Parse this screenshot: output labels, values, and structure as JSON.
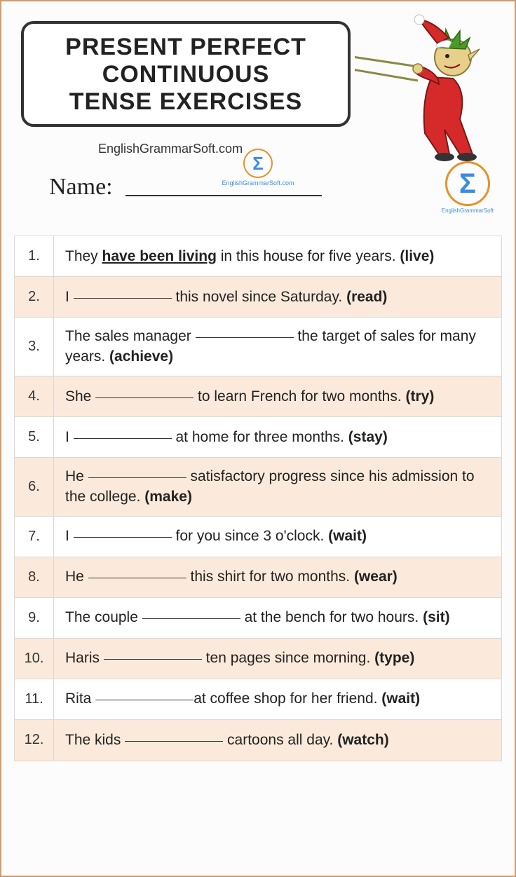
{
  "title_line1": "PRESENT PERFECT",
  "title_line2": "CONTINUOUS",
  "title_line3": "TENSE EXERCISES",
  "site": "EnglishGrammarSoft.com",
  "name_label": "Name:",
  "logo_text": "EnglishGrammarSoft",
  "exercises": [
    {
      "num": "1.",
      "pre": "They ",
      "answer": "have been living",
      "post": " in this house for five years. ",
      "verb": "(live)",
      "has_answer": true
    },
    {
      "num": "2.",
      "pre": "I ",
      "post": " this novel since Saturday. ",
      "verb": "(read)"
    },
    {
      "num": "3.",
      "pre": "The sales manager ",
      "post": " the target of sales for many years. ",
      "verb": "(achieve)"
    },
    {
      "num": "4.",
      "pre": "She ",
      "post": " to learn French for two months. ",
      "verb": "(try)"
    },
    {
      "num": "5.",
      "pre": "I ",
      "post": " at home for three months. ",
      "verb": "(stay)"
    },
    {
      "num": "6.",
      "pre": "He ",
      "post": " satisfactory progress since his admission to the college. ",
      "verb": "(make)"
    },
    {
      "num": "7.",
      "pre": "I ",
      "post": " for you since 3 o'clock. ",
      "verb": "(wait)"
    },
    {
      "num": "8.",
      "pre": "He ",
      "post": " this shirt for two months. ",
      "verb": "(wear)"
    },
    {
      "num": "9.",
      "pre": "The couple ",
      "post": " at the bench for two hours. ",
      "verb": "(sit)"
    },
    {
      "num": "10.",
      "pre": "Haris ",
      "post": " ten pages since morning. ",
      "verb": "(type)"
    },
    {
      "num": "11.",
      "pre": "Rita ",
      "post": "at coffee shop for her friend. ",
      "verb": "(wait)"
    },
    {
      "num": "12.",
      "pre": "The kids ",
      "post": " cartoons all day. ",
      "verb": "(watch)"
    }
  ]
}
